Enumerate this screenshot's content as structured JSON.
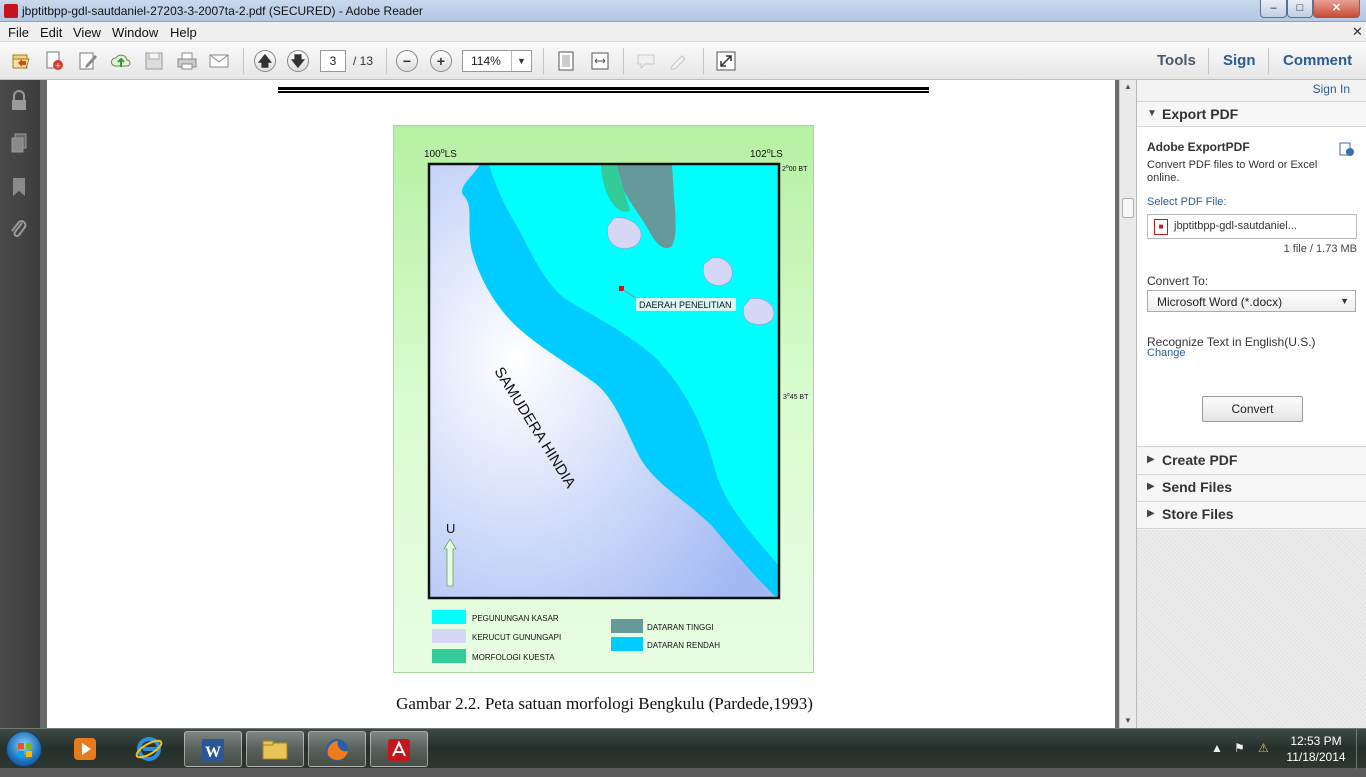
{
  "window": {
    "title": "jbptitbpp-gdl-sautdaniel-27203-3-2007ta-2.pdf (SECURED) - Adobe Reader",
    "minimize": "–",
    "maximize": "□",
    "close": "✕"
  },
  "menu": {
    "items": [
      "File",
      "Edit",
      "View",
      "Window",
      "Help"
    ],
    "close_doc": "✕"
  },
  "toolbar": {
    "page_current": "3",
    "page_total": "/ 13",
    "zoom": "114%",
    "tools_label": "Tools",
    "sign_label": "Sign",
    "comment_label": "Comment",
    "icons": [
      "open-icon",
      "create-pdf-icon",
      "edit-icon",
      "cloud-upload-icon",
      "save-icon",
      "print-icon",
      "email-icon",
      "page-up-icon",
      "page-down-icon",
      "zoom-out-icon",
      "zoom-in-icon",
      "fit-page-icon",
      "fit-width-icon",
      "comment-icon",
      "highlight-icon",
      "fullscreen-icon"
    ]
  },
  "left_nav": {
    "icons": [
      "lock-icon",
      "pages-icon",
      "bookmark-icon",
      "attachment-icon"
    ]
  },
  "document": {
    "map": {
      "lon_left": "100",
      "lon_left_unit": "LS",
      "lon_right": "102",
      "lon_right_unit": "LS",
      "lat_top": "2",
      "lat_top_suffix": "00 BT",
      "lat_mid": "3",
      "lat_mid_suffix": "45 BT",
      "degree": "o",
      "study_area": "DAERAH PENELITIAN",
      "ocean": "SAMUDERA HINDIA",
      "north": "U",
      "legend": [
        {
          "label": "PEGUNUNGAN KASAR",
          "color": "#00ffff"
        },
        {
          "label": "KERUCUT GUNUNGAPI",
          "color": "#d6d6f5"
        },
        {
          "label": "MORFOLOGI KUESTA",
          "color": "#33cc99"
        },
        {
          "label": "DATARAN TINGGI",
          "color": "#669999"
        },
        {
          "label": "DATARAN RENDAH",
          "color": "#00ccff"
        }
      ]
    },
    "caption": "Gambar 2.2. Peta satuan morfologi Bengkulu (Pardede,1993)"
  },
  "right_panel": {
    "sign_in": "Sign In",
    "export_section": "Export PDF",
    "export_title": "Adobe ExportPDF",
    "export_desc": "Convert PDF files to Word or Excel online.",
    "select_label": "Select PDF File:",
    "file_name": "jbptitbpp-gdl-sautdaniel...",
    "file_meta": "1 file / 1.73 MB",
    "convert_to_label": "Convert To:",
    "convert_to_value": "Microsoft Word (*.docx)",
    "recognize": "Recognize Text in English(U.S.)",
    "change": "Change",
    "convert_button": "Convert",
    "sections": [
      "Create PDF",
      "Send Files",
      "Store Files"
    ]
  },
  "taskbar": {
    "apps": [
      "media-player-icon",
      "internet-explorer-icon",
      "word-icon",
      "file-explorer-icon",
      "firefox-icon",
      "adobe-reader-icon"
    ],
    "time": "12:53 PM",
    "date": "11/18/2014"
  }
}
